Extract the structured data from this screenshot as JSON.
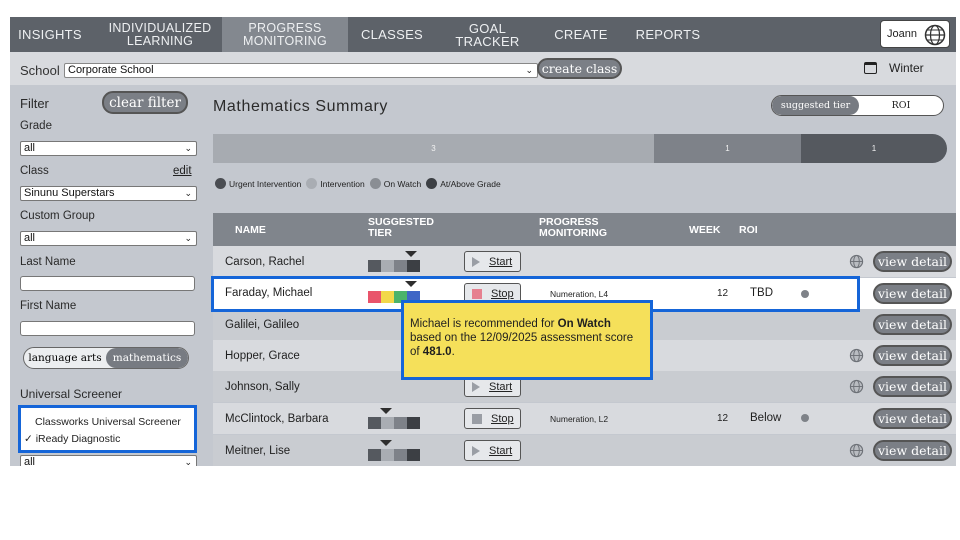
{
  "nav": {
    "items": [
      {
        "label": "INSIGHTS"
      },
      {
        "label": "INDIVIDUALIZED LEARNING"
      },
      {
        "label": "PROGRESS MONITORING"
      },
      {
        "label": "CLASSES"
      },
      {
        "label": "GOAL TRACKER"
      },
      {
        "label": "CREATE"
      },
      {
        "label": "REPORTS"
      }
    ],
    "active": "PROGRESS MONITORING",
    "user": "Joann"
  },
  "school_bar": {
    "label": "School",
    "selected": "Corporate School",
    "create_class": "create class",
    "term": "Winter"
  },
  "filters": {
    "title": "Filter",
    "clear": "clear filter",
    "grade_label": "Grade",
    "grade_value": "all",
    "class_label": "Class",
    "class_edit": "edit",
    "class_value": "Sinunu Superstars",
    "custom_group_label": "Custom Group",
    "custom_group_value": "all",
    "last_name_label": "Last Name",
    "last_name_value": "",
    "first_name_label": "First Name",
    "first_name_value": "",
    "subjects": [
      "language arts",
      "mathematics"
    ],
    "subject_selected": "mathematics",
    "screener_label": "Universal Screener",
    "screener_options": [
      "Classworks Universal Screener",
      "✓ iReady Diagnostic"
    ],
    "screener_selected": "iReady Diagnostic",
    "bottom_select_value": "all"
  },
  "main": {
    "title": "Mathematics Summary",
    "tier_toggle": [
      "suggested tier",
      "ROI"
    ],
    "tier_toggle_selected": "suggested tier",
    "distribution": [
      {
        "count": "3",
        "color": "#a7abb1"
      },
      {
        "count": "1",
        "color": "#7e8289"
      },
      {
        "count": "1",
        "color": "#55595f"
      }
    ],
    "legend": [
      {
        "label": "Urgent Intervention",
        "color": "#4a4d52"
      },
      {
        "label": "Intervention",
        "color": "#a9adb3"
      },
      {
        "label": "On Watch",
        "color": "#8a8e94"
      },
      {
        "label": "At/Above Grade",
        "color": "#3c3f44"
      }
    ]
  },
  "table": {
    "headers": {
      "name": "NAME",
      "suggested_tier": "SUGGESTED TIER",
      "progress_monitoring": "PROGRESS MONITORING",
      "week": "WEEK",
      "roi": "ROI"
    },
    "rows": [
      {
        "name": "Carson, Rachel",
        "action": "Start",
        "pm": "",
        "week": "",
        "roi": "",
        "view": "view detail"
      },
      {
        "name": "Faraday, Michael",
        "action": "Stop",
        "pm": "Numeration, L4",
        "week": "12",
        "roi": "TBD",
        "view": "view detail"
      },
      {
        "name": "Galilei, Galileo",
        "action": "",
        "pm": "",
        "week": "",
        "roi": "",
        "view": "view detail"
      },
      {
        "name": "Hopper, Grace",
        "action": "",
        "pm": "",
        "week": "",
        "roi": "",
        "view": "view detail"
      },
      {
        "name": "Johnson, Sally",
        "action": "Start",
        "pm": "",
        "week": "",
        "roi": "",
        "view": "view detail"
      },
      {
        "name": "McClintock, Barbara",
        "action": "Stop",
        "pm": "Numeration, L2",
        "week": "12",
        "roi": "Below",
        "view": "view detail"
      },
      {
        "name": "Meitner, Lise",
        "action": "Start",
        "pm": "",
        "week": "",
        "roi": "",
        "view": "view detail"
      }
    ]
  },
  "tooltip": {
    "part1": "Michael is recommended for ",
    "tier": "On Watch",
    "part2": " based on the 12/09/2025 assessment score of ",
    "score": "481.0",
    "part3": "."
  },
  "colors": {
    "tier_urgent": "#e9546b",
    "tier_intervention": "#f2d84a",
    "tier_watch": "#4bb36a",
    "tier_above": "#3f66c6",
    "highlight": "#1565d8",
    "tooltip_bg": "#f5e05a"
  }
}
